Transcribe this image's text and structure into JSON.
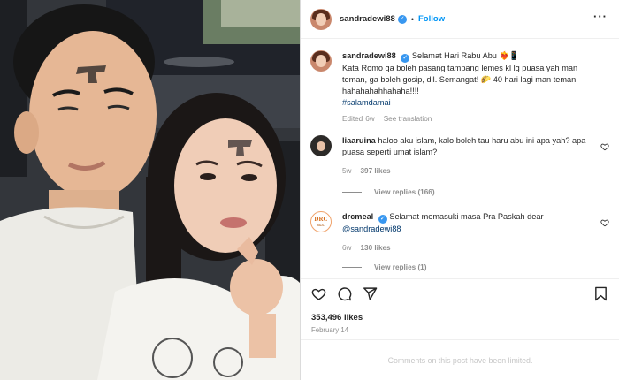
{
  "post": {
    "username": "sandradewi88",
    "verified_mark": "✓",
    "separator": "•",
    "follow_label": "Follow",
    "more_label": "···"
  },
  "caption": {
    "username": "sandradewi88",
    "line1": "Selamat Hari Rabu Abu ❤️‍🔥📱",
    "text": "Kata Romo ga boleh pasang tampang lemes kl lg puasa yah man teman, ga boleh gosip, dll. Semangat! 🌮 40 hari lagi man teman hahahahahhahaha!!!!",
    "hashtag": "#salamdamai",
    "edited": "Edited",
    "age": "6w",
    "see_translation": "See translation"
  },
  "comments": [
    {
      "username": "liaaruina",
      "text": "haloo aku islam, kalo boleh tau haru abu ini apa yah? apa puasa seperti umat islam?",
      "age": "5w",
      "likes": "397 likes",
      "replies": "View replies (166)"
    },
    {
      "username": "drcmeal",
      "text": "Selamat memasuki masa Pra Paskah dear",
      "mention": "@sandradewi88",
      "age": "6w",
      "likes": "130 likes",
      "replies": "View replies (1)",
      "logo_text": "DRC",
      "logo_sub": "MEAL"
    }
  ],
  "actions": {
    "like_icon": "heart-icon",
    "comment_icon": "comment-icon",
    "share_icon": "share-icon",
    "save_icon": "bookmark-icon",
    "likes_count": "353,496 likes",
    "date": "February 14"
  },
  "footer": {
    "limited_text": "Comments on this post have been limited."
  },
  "colors": {
    "accent": "#0095f6",
    "verified": "#3897f0",
    "muted": "#8e8e8e",
    "border": "#dbdbdb",
    "heart": "#e0245e"
  }
}
